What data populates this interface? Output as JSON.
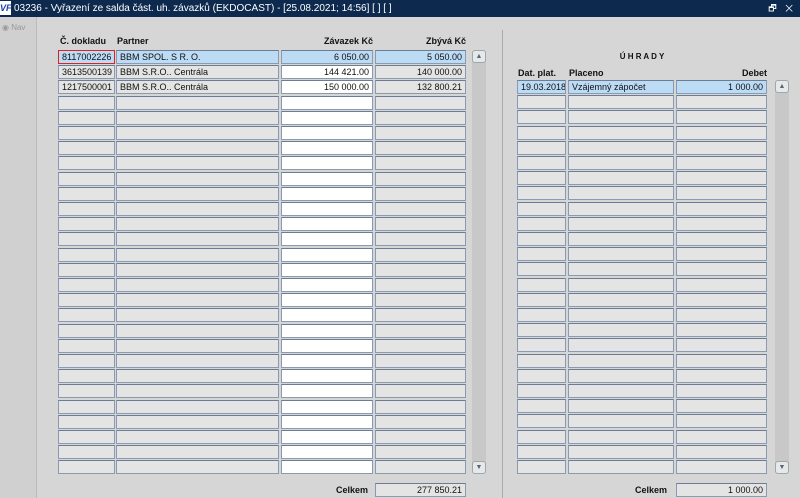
{
  "window": {
    "title": "03236 - Vyřazení ze salda část. uh. závazků (EKDOCAST) - [25.08.2021; 14:56]  [ ]  [ ]",
    "logo": "VF",
    "controls": "🗗 ✕"
  },
  "nav": {
    "label": "Nav"
  },
  "left": {
    "headers": [
      "Č. dokladu",
      "Partner",
      "Závazek Kč",
      "Zbývá Kč"
    ],
    "rows": [
      [
        "8117002226",
        "BBM SPOL. S R. O.",
        "6 050.00",
        "5 050.00"
      ],
      [
        "3613500139",
        "BBM S.R.O.. Centrála",
        "144 421.00",
        "140 000.00"
      ],
      [
        "1217500001",
        "BBM S.R.O.. Centrála",
        "150 000.00",
        "132 800.21"
      ]
    ],
    "total_label": "Celkem",
    "total": "277 850.21"
  },
  "right": {
    "title": "Ú H R A D Y",
    "headers": [
      "Dat. plat.",
      "Placeno",
      "Debet"
    ],
    "rows": [
      [
        "19.03.2018",
        "Vzájemný zápočet",
        "1 000.00"
      ]
    ],
    "total_label": "Celkem",
    "total": "1 000.00"
  }
}
